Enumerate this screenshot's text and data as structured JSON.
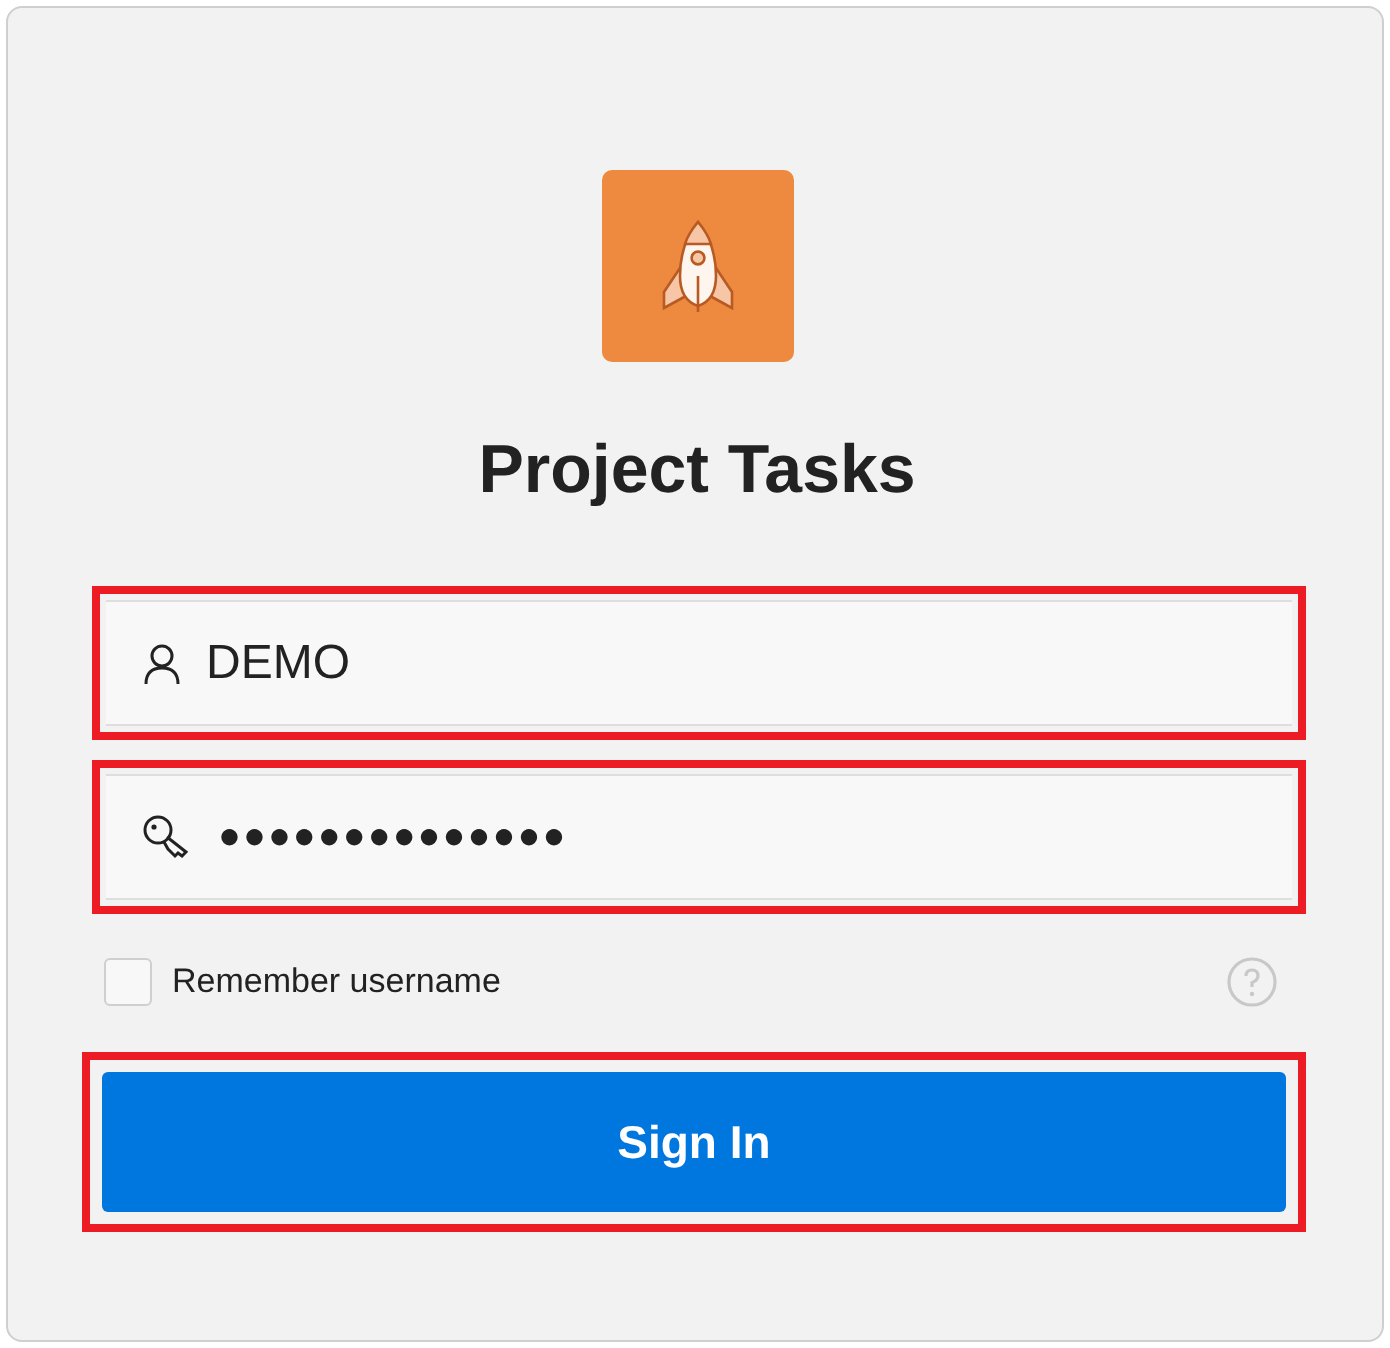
{
  "app": {
    "title": "Project Tasks"
  },
  "fields": [
    {
      "kind": "username",
      "value": "DEMO",
      "highlighted": true
    },
    {
      "kind": "password",
      "value": "●●●●●●●●●●●●●●",
      "highlighted": true
    }
  ],
  "remember": {
    "label": "Remember username",
    "checked": false
  },
  "sign_in": {
    "label": "Sign In",
    "highlighted": true
  }
}
